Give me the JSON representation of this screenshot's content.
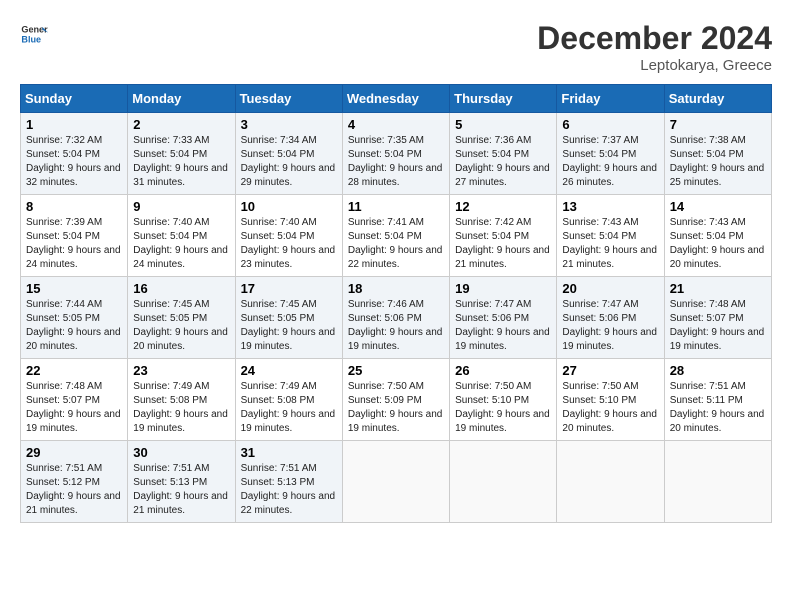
{
  "header": {
    "logo_line1": "General",
    "logo_line2": "Blue",
    "month": "December 2024",
    "location": "Leptokarya, Greece"
  },
  "weekdays": [
    "Sunday",
    "Monday",
    "Tuesday",
    "Wednesday",
    "Thursday",
    "Friday",
    "Saturday"
  ],
  "weeks": [
    [
      {
        "day": "1",
        "sunrise": "Sunrise: 7:32 AM",
        "sunset": "Sunset: 5:04 PM",
        "daylight": "Daylight: 9 hours and 32 minutes."
      },
      {
        "day": "2",
        "sunrise": "Sunrise: 7:33 AM",
        "sunset": "Sunset: 5:04 PM",
        "daylight": "Daylight: 9 hours and 31 minutes."
      },
      {
        "day": "3",
        "sunrise": "Sunrise: 7:34 AM",
        "sunset": "Sunset: 5:04 PM",
        "daylight": "Daylight: 9 hours and 29 minutes."
      },
      {
        "day": "4",
        "sunrise": "Sunrise: 7:35 AM",
        "sunset": "Sunset: 5:04 PM",
        "daylight": "Daylight: 9 hours and 28 minutes."
      },
      {
        "day": "5",
        "sunrise": "Sunrise: 7:36 AM",
        "sunset": "Sunset: 5:04 PM",
        "daylight": "Daylight: 9 hours and 27 minutes."
      },
      {
        "day": "6",
        "sunrise": "Sunrise: 7:37 AM",
        "sunset": "Sunset: 5:04 PM",
        "daylight": "Daylight: 9 hours and 26 minutes."
      },
      {
        "day": "7",
        "sunrise": "Sunrise: 7:38 AM",
        "sunset": "Sunset: 5:04 PM",
        "daylight": "Daylight: 9 hours and 25 minutes."
      }
    ],
    [
      {
        "day": "8",
        "sunrise": "Sunrise: 7:39 AM",
        "sunset": "Sunset: 5:04 PM",
        "daylight": "Daylight: 9 hours and 24 minutes."
      },
      {
        "day": "9",
        "sunrise": "Sunrise: 7:40 AM",
        "sunset": "Sunset: 5:04 PM",
        "daylight": "Daylight: 9 hours and 24 minutes."
      },
      {
        "day": "10",
        "sunrise": "Sunrise: 7:40 AM",
        "sunset": "Sunset: 5:04 PM",
        "daylight": "Daylight: 9 hours and 23 minutes."
      },
      {
        "day": "11",
        "sunrise": "Sunrise: 7:41 AM",
        "sunset": "Sunset: 5:04 PM",
        "daylight": "Daylight: 9 hours and 22 minutes."
      },
      {
        "day": "12",
        "sunrise": "Sunrise: 7:42 AM",
        "sunset": "Sunset: 5:04 PM",
        "daylight": "Daylight: 9 hours and 21 minutes."
      },
      {
        "day": "13",
        "sunrise": "Sunrise: 7:43 AM",
        "sunset": "Sunset: 5:04 PM",
        "daylight": "Daylight: 9 hours and 21 minutes."
      },
      {
        "day": "14",
        "sunrise": "Sunrise: 7:43 AM",
        "sunset": "Sunset: 5:04 PM",
        "daylight": "Daylight: 9 hours and 20 minutes."
      }
    ],
    [
      {
        "day": "15",
        "sunrise": "Sunrise: 7:44 AM",
        "sunset": "Sunset: 5:05 PM",
        "daylight": "Daylight: 9 hours and 20 minutes."
      },
      {
        "day": "16",
        "sunrise": "Sunrise: 7:45 AM",
        "sunset": "Sunset: 5:05 PM",
        "daylight": "Daylight: 9 hours and 20 minutes."
      },
      {
        "day": "17",
        "sunrise": "Sunrise: 7:45 AM",
        "sunset": "Sunset: 5:05 PM",
        "daylight": "Daylight: 9 hours and 19 minutes."
      },
      {
        "day": "18",
        "sunrise": "Sunrise: 7:46 AM",
        "sunset": "Sunset: 5:06 PM",
        "daylight": "Daylight: 9 hours and 19 minutes."
      },
      {
        "day": "19",
        "sunrise": "Sunrise: 7:47 AM",
        "sunset": "Sunset: 5:06 PM",
        "daylight": "Daylight: 9 hours and 19 minutes."
      },
      {
        "day": "20",
        "sunrise": "Sunrise: 7:47 AM",
        "sunset": "Sunset: 5:06 PM",
        "daylight": "Daylight: 9 hours and 19 minutes."
      },
      {
        "day": "21",
        "sunrise": "Sunrise: 7:48 AM",
        "sunset": "Sunset: 5:07 PM",
        "daylight": "Daylight: 9 hours and 19 minutes."
      }
    ],
    [
      {
        "day": "22",
        "sunrise": "Sunrise: 7:48 AM",
        "sunset": "Sunset: 5:07 PM",
        "daylight": "Daylight: 9 hours and 19 minutes."
      },
      {
        "day": "23",
        "sunrise": "Sunrise: 7:49 AM",
        "sunset": "Sunset: 5:08 PM",
        "daylight": "Daylight: 9 hours and 19 minutes."
      },
      {
        "day": "24",
        "sunrise": "Sunrise: 7:49 AM",
        "sunset": "Sunset: 5:08 PM",
        "daylight": "Daylight: 9 hours and 19 minutes."
      },
      {
        "day": "25",
        "sunrise": "Sunrise: 7:50 AM",
        "sunset": "Sunset: 5:09 PM",
        "daylight": "Daylight: 9 hours and 19 minutes."
      },
      {
        "day": "26",
        "sunrise": "Sunrise: 7:50 AM",
        "sunset": "Sunset: 5:10 PM",
        "daylight": "Daylight: 9 hours and 19 minutes."
      },
      {
        "day": "27",
        "sunrise": "Sunrise: 7:50 AM",
        "sunset": "Sunset: 5:10 PM",
        "daylight": "Daylight: 9 hours and 20 minutes."
      },
      {
        "day": "28",
        "sunrise": "Sunrise: 7:51 AM",
        "sunset": "Sunset: 5:11 PM",
        "daylight": "Daylight: 9 hours and 20 minutes."
      }
    ],
    [
      {
        "day": "29",
        "sunrise": "Sunrise: 7:51 AM",
        "sunset": "Sunset: 5:12 PM",
        "daylight": "Daylight: 9 hours and 21 minutes."
      },
      {
        "day": "30",
        "sunrise": "Sunrise: 7:51 AM",
        "sunset": "Sunset: 5:13 PM",
        "daylight": "Daylight: 9 hours and 21 minutes."
      },
      {
        "day": "31",
        "sunrise": "Sunrise: 7:51 AM",
        "sunset": "Sunset: 5:13 PM",
        "daylight": "Daylight: 9 hours and 22 minutes."
      },
      null,
      null,
      null,
      null
    ]
  ]
}
